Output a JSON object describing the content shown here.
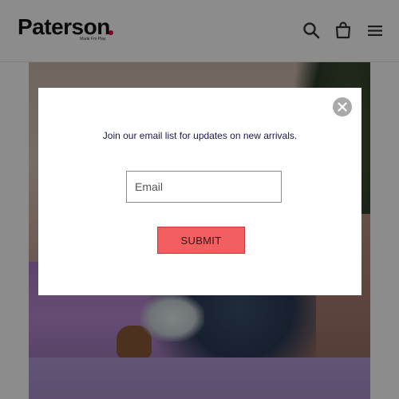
{
  "brand": {
    "name": "Paterson",
    "tagline": "Made For Play",
    "accent_color": "#e4003a"
  },
  "header": {
    "icons": [
      "search-icon",
      "cart-icon",
      "menu-icon"
    ]
  },
  "hero": {
    "image": "person-sitting-on-purple-wall-photo"
  },
  "modal": {
    "message": "Join our email list for updates on new arrivals.",
    "email_placeholder": "Email",
    "submit_label": "SUBMIT",
    "close_icon": "close-icon",
    "button_color": "#f35f61"
  }
}
